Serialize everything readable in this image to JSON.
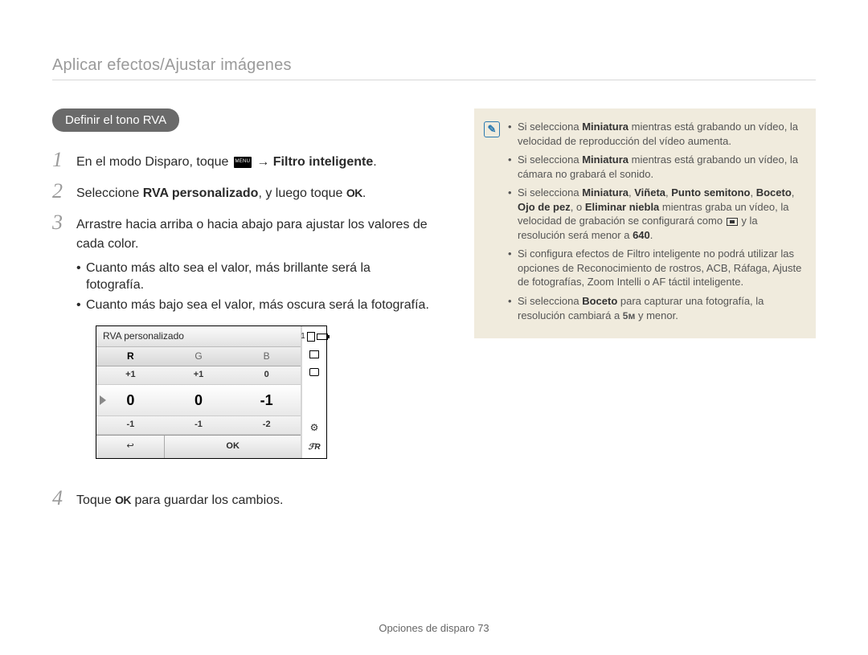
{
  "breadcrumb": "Aplicar efectos/Ajustar imágenes",
  "pill": "Definir el tono RVA",
  "steps": {
    "s1_a": "En el modo Disparo, toque ",
    "s1_b": " → ",
    "s1_c": "Filtro inteligente",
    "s1_d": ".",
    "s2_a": "Seleccione ",
    "s2_b": "RVA personalizado",
    "s2_c": ", y luego toque ",
    "s2_ok": "OK",
    "s2_d": ".",
    "s3_a": "Arrastre hacia arriba o hacia abajo para ajustar los valores de cada color.",
    "s3_b1": "Cuanto más alto sea el valor, más brillante será la fotografía.",
    "s3_b2": "Cuanto más bajo sea el valor, más oscura será la fotografía.",
    "s4_a": "Toque ",
    "s4_ok": "OK",
    "s4_b": " para guardar los cambios."
  },
  "lcd": {
    "title": "RVA personalizado",
    "headers": [
      "R",
      "G",
      "B"
    ],
    "row_top": [
      "+1",
      "+1",
      "0"
    ],
    "row_mid": [
      "0",
      "0",
      "-1"
    ],
    "row_bot": [
      "-1",
      "-1",
      "-2"
    ],
    "back": "↩",
    "ok": "OK",
    "side_count": "1",
    "side_fr": "ℱR"
  },
  "info": {
    "n1_a": "Si selecciona ",
    "n1_b": "Miniatura",
    "n1_c": " mientras está grabando un vídeo, la velocidad de reproducción del vídeo aumenta.",
    "n2_a": "Si selecciona ",
    "n2_b": "Miniatura",
    "n2_c": " mientras está grabando un vídeo, la cámara no grabará el sonido.",
    "n3_a": "Si selecciona ",
    "n3_b": "Miniatura",
    "n3_c": ", ",
    "n3_d": "Viñeta",
    "n3_e": ", ",
    "n3_f": "Punto semitono",
    "n3_g": ", ",
    "n3_h": "Boceto",
    "n3_i": ", ",
    "n3_j": "Ojo de pez",
    "n3_k": ", o ",
    "n3_l": "Eliminar niebla",
    "n3_m": " mientras graba un vídeo, la velocidad de grabación se configurará como ",
    "n3_n": " y la resolución será menor a ",
    "n3_o": "640",
    "n3_p": ".",
    "n4": "Si configura efectos de Filtro inteligente no podrá utilizar las opciones de Reconocimiento de rostros, ACB, Ráfaga, Ajuste de fotografías, Zoom Intelli o AF táctil inteligente.",
    "n5_a": "Si selecciona ",
    "n5_b": "Boceto",
    "n5_c": " para capturar una fotografía, la resolución cambiará a ",
    "n5_d": "5ᴍ",
    "n5_e": " y menor."
  },
  "footer_a": "Opciones de disparo  ",
  "footer_b": "73"
}
